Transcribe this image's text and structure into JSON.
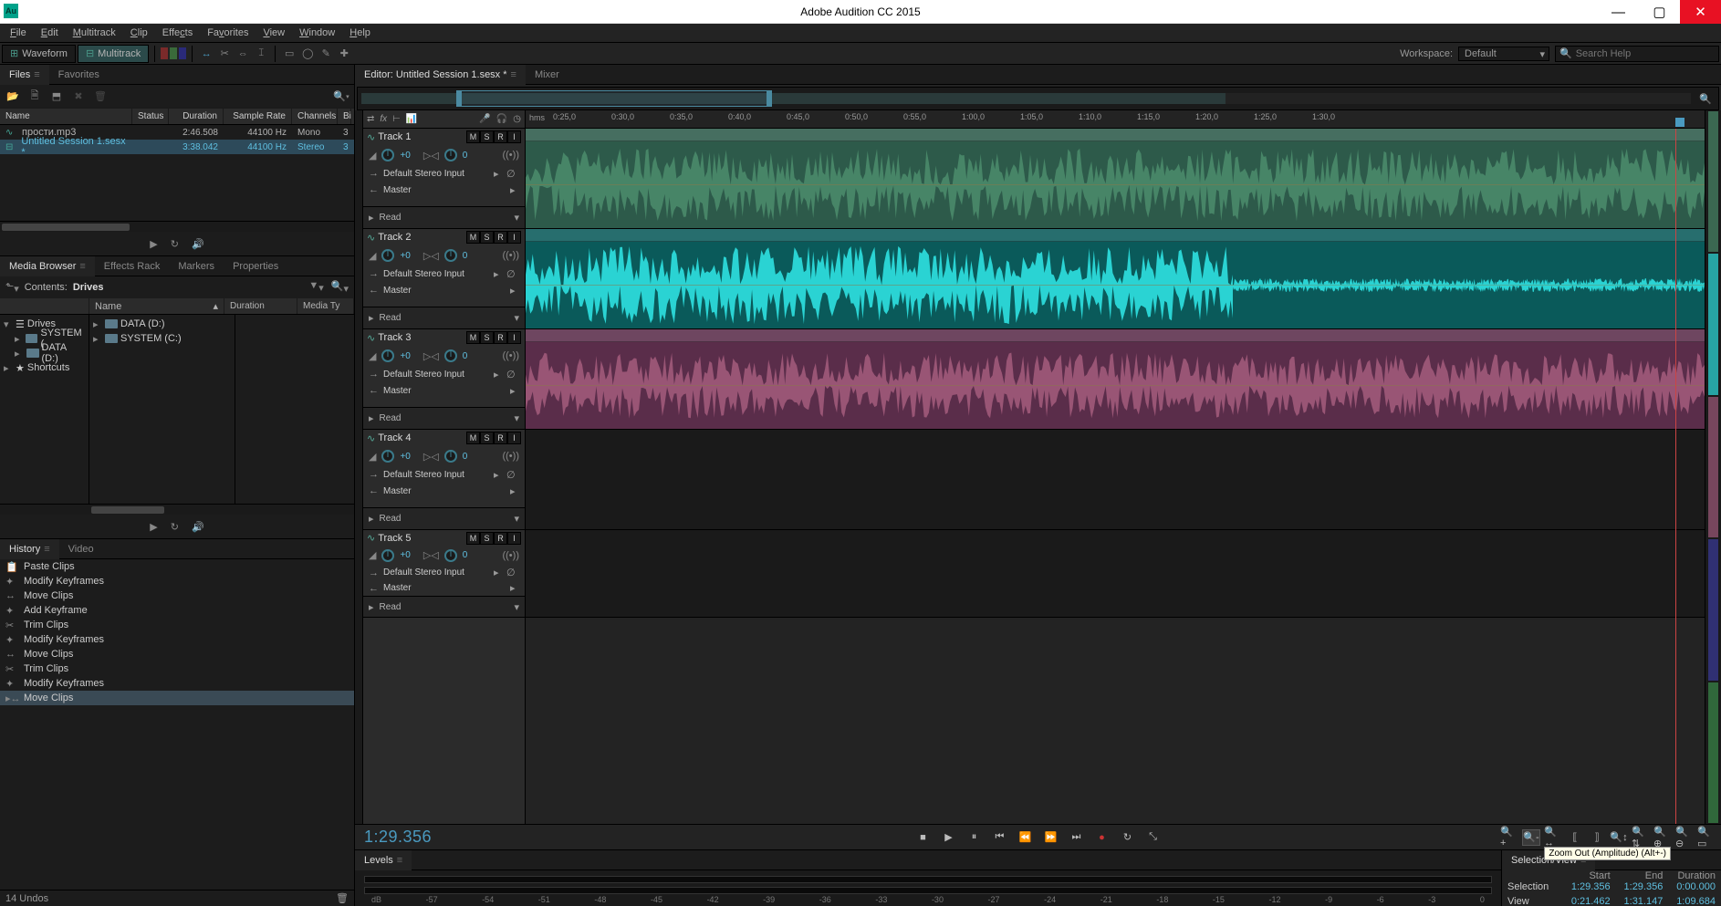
{
  "app": {
    "title": "Adobe Audition CC 2015",
    "icon_text": "Au"
  },
  "menu": [
    "File",
    "Edit",
    "Multitrack",
    "Clip",
    "Effects",
    "Favorites",
    "View",
    "Window",
    "Help"
  ],
  "toolbar": {
    "waveform": "Waveform",
    "multitrack": "Multitrack",
    "workspace_label": "Workspace:",
    "workspace_value": "Default",
    "search_placeholder": "Search Help"
  },
  "files_panel": {
    "tab_files": "Files",
    "tab_favorites": "Favorites",
    "headers": {
      "name": "Name",
      "status": "Status",
      "duration": "Duration",
      "sample_rate": "Sample Rate",
      "channels": "Channels",
      "bit": "Bi"
    },
    "rows": [
      {
        "name": "прости.mp3",
        "status": "",
        "duration": "2:46.508",
        "sample_rate": "44100 Hz",
        "channels": "Mono",
        "bit": "3"
      },
      {
        "name": "Untitled Session 1.sesx *",
        "status": "",
        "duration": "3:38.042",
        "sample_rate": "44100 Hz",
        "channels": "Stereo",
        "bit": "3"
      }
    ]
  },
  "media_browser": {
    "tabs": [
      "Media Browser",
      "Effects Rack",
      "Markers",
      "Properties"
    ],
    "contents_label": "Contents:",
    "contents_value": "Drives",
    "headers": {
      "name": "Name",
      "duration": "Duration",
      "media": "Media Ty"
    },
    "tree_left": [
      {
        "label": "Drives",
        "children": [
          "SYSTEM (",
          "DATA (D:)"
        ]
      },
      {
        "label": "Shortcuts"
      }
    ],
    "tree_right": [
      {
        "label": "Name",
        "children": [
          "DATA (D:)",
          "SYSTEM (C:)"
        ]
      }
    ]
  },
  "history": {
    "tabs": [
      "History",
      "Video"
    ],
    "items": [
      "Paste Clips",
      "Modify Keyframes",
      "Move Clips",
      "Add Keyframe",
      "Trim Clips",
      "Modify Keyframes",
      "Move Clips",
      "Trim Clips",
      "Modify Keyframes",
      "Move Clips"
    ],
    "selected_index": 9,
    "status": "14 Undos"
  },
  "editor": {
    "tab_editor": "Editor: Untitled Session 1.sesx *",
    "tab_mixer": "Mixer",
    "ruler_hms": "hms",
    "ticks": [
      "0:25,0",
      "0:30,0",
      "0:35,0",
      "0:40,0",
      "0:45,0",
      "0:50,0",
      "0:55,0",
      "1:00,0",
      "1:05,0",
      "1:10,0",
      "1:15,0",
      "1:20,0",
      "1:25,0",
      "1:30,0"
    ],
    "timecode": "1:29.356",
    "tooltip": "Zoom Out (Amplitude) (Alt+-)",
    "tracks": [
      {
        "name": "Track 1",
        "color": "#2d5a4a",
        "clip_color": "#4a8a6a",
        "input": "Default Stereo Input",
        "output": "Master",
        "automation": "Read",
        "vol": "+0",
        "pan": "0",
        "nub": "#1aaa7a"
      },
      {
        "name": "Track 2",
        "color": "#0a5a5a",
        "clip_color": "#2de0e0",
        "input": "Default Stereo Input",
        "output": "Master",
        "automation": "Read",
        "vol": "+0",
        "pan": "0",
        "nub": "#1ad0d0"
      },
      {
        "name": "Track 3",
        "color": "#5a2d4a",
        "clip_color": "#a05a7a",
        "input": "Default Stereo Input",
        "output": "Master",
        "automation": "Read",
        "vol": "+0",
        "pan": "0",
        "nub": "#c02a7a"
      },
      {
        "name": "Track 4",
        "color": "#2a2a6a",
        "clip_color": "#3a3a9a",
        "input": "Default Stereo Input",
        "output": "Master",
        "automation": "Read",
        "vol": "+0",
        "pan": "0",
        "nub": "#3a3aca"
      },
      {
        "name": "Track 5",
        "color": "#2d5a3a",
        "clip_color": "#3a8a4a",
        "input": "Default Stereo Input",
        "output": "Master",
        "automation": "Read",
        "vol": "+0",
        "pan": "0",
        "nub": "#2a9a3a"
      }
    ],
    "msri": [
      "M",
      "S",
      "R",
      "I"
    ],
    "vol_icon": "volume-icon",
    "pan_icon": "pan-icon"
  },
  "levels": {
    "tab": "Levels",
    "db_marks": [
      "dB",
      "-57",
      "-54",
      "-51",
      "-48",
      "-45",
      "-42",
      "-39",
      "-36",
      "-33",
      "-30",
      "-27",
      "-24",
      "-21",
      "-18",
      "-15",
      "-12",
      "-9",
      "-6",
      "-3",
      "0"
    ]
  },
  "selview": {
    "tab": "Selection/View",
    "head": [
      "",
      "Start",
      "End",
      "Duration"
    ],
    "rows": [
      {
        "label": "Selection",
        "start": "1:29.356",
        "end": "1:29.356",
        "dur": "0:00.000"
      },
      {
        "label": "View",
        "start": "0:21.462",
        "end": "1:31.147",
        "dur": "1:09.684"
      }
    ]
  }
}
